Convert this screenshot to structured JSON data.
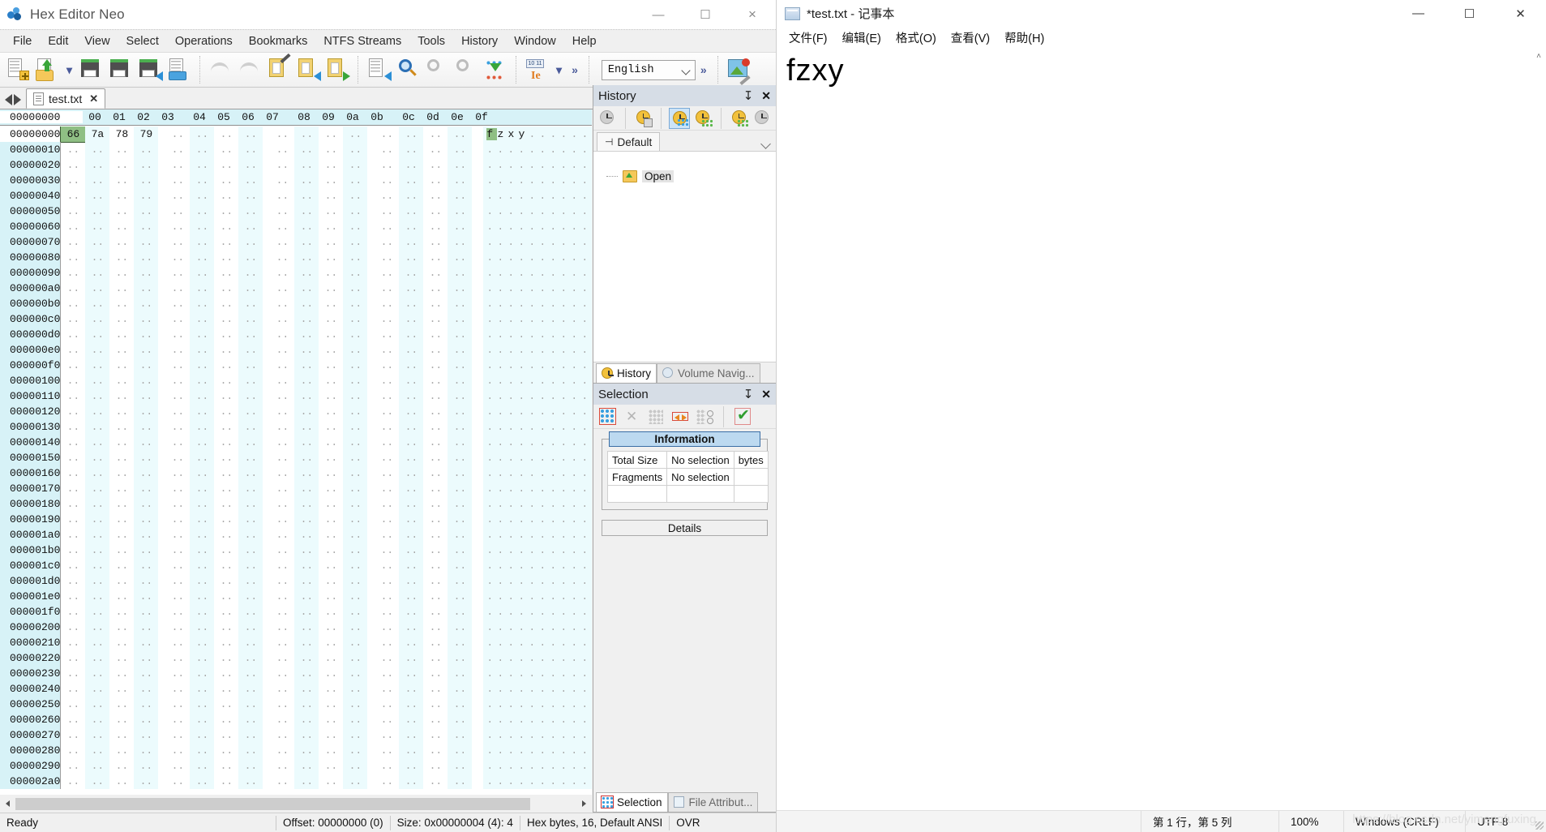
{
  "hex_editor": {
    "window_title": "Hex Editor Neo",
    "window_buttons": {
      "minimize": "—",
      "maximize": "☐",
      "close": "×"
    },
    "menubar": [
      "File",
      "Edit",
      "View",
      "Select",
      "Operations",
      "Bookmarks",
      "NTFS Streams",
      "Tools",
      "History",
      "Window",
      "Help"
    ],
    "toolbar": {
      "overflow_chevron": "»",
      "language_value": "English",
      "icons": [
        "new-file-icon",
        "open-file-icon",
        "open-dropdown-icon",
        "save-icon",
        "save-as-icon",
        "save-all-icon",
        "print-icon",
        "undo-icon",
        "redo-icon",
        "edit-clipboard-icon",
        "paste-icon",
        "copy-icon",
        "export-icon",
        "find-icon",
        "find-prev-icon",
        "find-next-icon",
        "fill-icon",
        "data-inspector-icon"
      ]
    },
    "tab": {
      "label": "test.txt",
      "close": "✕"
    },
    "hex_view": {
      "column_headers": [
        "00",
        "01",
        "02",
        "03",
        "04",
        "05",
        "06",
        "07",
        "08",
        "09",
        "0a",
        "0b",
        "0c",
        "0d",
        "0e",
        "0f"
      ],
      "offset_header": "00000000",
      "selected_byte": "66",
      "first_row_values": [
        "66",
        "7a",
        "78",
        "79"
      ],
      "empty_cell": "..",
      "ascii_first_row": "fzxy",
      "ascii_selected_char": "f",
      "offsets": [
        "00000000",
        "00000010",
        "00000020",
        "00000030",
        "00000040",
        "00000050",
        "00000060",
        "00000070",
        "00000080",
        "00000090",
        "000000a0",
        "000000b0",
        "000000c0",
        "000000d0",
        "000000e0",
        "000000f0",
        "00000100",
        "00000110",
        "00000120",
        "00000130",
        "00000140",
        "00000150",
        "00000160",
        "00000170",
        "00000180",
        "00000190",
        "000001a0",
        "000001b0",
        "000001c0",
        "000001d0",
        "000001e0",
        "000001f0",
        "00000200",
        "00000210",
        "00000220",
        "00000230",
        "00000240",
        "00000250",
        "00000260",
        "00000270",
        "00000280",
        "00000290",
        "000002a0"
      ]
    },
    "history_panel": {
      "title": "History",
      "pin": "↧",
      "close": "✕",
      "toolbar_icons": [
        "history-list-icon",
        "clear-history-icon",
        "branch-view-icon",
        "tree-view-icon",
        "save-history-icon",
        "load-history-icon"
      ],
      "branch_tab": "Default",
      "branch_pin_icon": "pin-icon",
      "dropdown_icon": "chevron-down-icon",
      "nodes": [
        {
          "label": "Open",
          "icon": "open-folder-icon"
        }
      ]
    },
    "dock_tabs_upper": [
      {
        "label": "History",
        "icon": "clock-icon",
        "selected": true
      },
      {
        "label": "Volume Navig...",
        "icon": "volume-icon",
        "selected": false
      }
    ],
    "selection_panel": {
      "title": "Selection",
      "pin": "↧",
      "close": "✕",
      "toolbar_icons": [
        "select-all-icon",
        "deselect-icon",
        "invert-selection-icon",
        "expand-selection-icon",
        "partial-selection-icon",
        "apply-selection-icon"
      ],
      "information_legend": "Information",
      "rows": [
        {
          "label": "Total Size",
          "value": "No selection",
          "unit": "bytes"
        },
        {
          "label": "Fragments",
          "value": "No selection",
          "unit": ""
        },
        {
          "label": "",
          "value": "",
          "unit": ""
        }
      ],
      "details_button": "Details"
    },
    "dock_tabs_lower": [
      {
        "label": "Selection",
        "icon": "selection-icon",
        "selected": true
      },
      {
        "label": "File Attribut...",
        "icon": "file-attributes-icon",
        "selected": false
      }
    ],
    "status_bar": {
      "ready": "Ready",
      "offset": "Offset: 00000000 (0)",
      "size": "Size: 0x00000004 (4): 4",
      "mode": "Hex bytes, 16, Default ANSI",
      "insert_mode": "OVR"
    }
  },
  "notepad": {
    "window_title": "*test.txt - 记事本",
    "window_buttons": {
      "minimize": "—",
      "maximize": "☐",
      "close": "✕"
    },
    "menubar": [
      "文件(F)",
      "编辑(E)",
      "格式(O)",
      "查看(V)",
      "帮助(H)"
    ],
    "content": "fzxy",
    "status_bar": {
      "position": "第 1 行，第 5 列",
      "zoom": "100%",
      "line_ending": "Windows (CRLF)",
      "encoding": "UTF-8"
    },
    "watermark": "https://blog.csdn.net/yimengfuxing"
  },
  "colors": {
    "hex_header_bg": "#d7f2f7",
    "offset_bg": "#d7f2f7",
    "alt_column_bg": "#ecfbfd",
    "selection_green": "#8fbf84",
    "panel_title_bg": "#d6dde6",
    "info_legend_bg": "#bcd9f0"
  }
}
